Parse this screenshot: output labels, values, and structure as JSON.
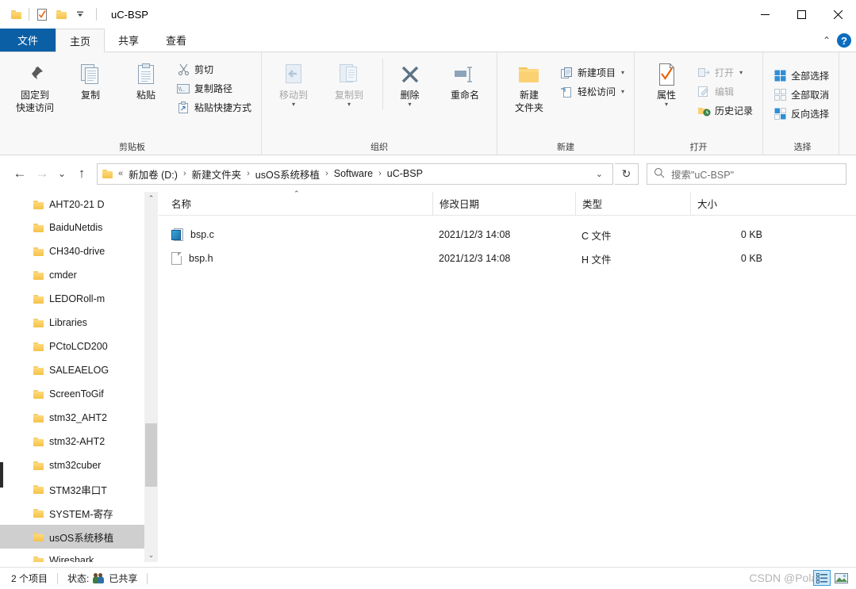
{
  "window": {
    "title": "uC-BSP",
    "quick_access": [
      {
        "name": "folder-icon",
        "label": "文件资源管理器"
      },
      {
        "name": "properties-icon",
        "label": "属性"
      },
      {
        "name": "new-folder-icon",
        "label": "新建文件夹"
      },
      {
        "name": "customize-caret-icon",
        "label": "自定义快速访问工具栏"
      }
    ],
    "controls": {
      "minimize": "─",
      "maximize": "☐",
      "close": "✕"
    }
  },
  "tabs": [
    {
      "label": "文件",
      "state": "file"
    },
    {
      "label": "主页",
      "state": "active"
    },
    {
      "label": "共享",
      "state": "normal"
    },
    {
      "label": "查看",
      "state": "normal"
    }
  ],
  "tabrow_right": {
    "collapse": "⌃",
    "help": "?"
  },
  "ribbon": {
    "groups": [
      {
        "title": "剪贴板",
        "big": [
          {
            "label1": "固定到",
            "label2": "快速访问",
            "icon": "pin-icon"
          },
          {
            "label1": "复制",
            "label2": "",
            "icon": "copy-icon"
          },
          {
            "label1": "粘贴",
            "label2": "",
            "icon": "paste-icon"
          }
        ],
        "small": [
          {
            "label": "剪切",
            "icon": "cut-icon",
            "disabled": false
          },
          {
            "label": "复制路径",
            "icon": "copy-path-icon",
            "disabled": false
          },
          {
            "label": "粘贴快捷方式",
            "icon": "paste-shortcut-icon",
            "disabled": false
          }
        ]
      },
      {
        "title": "组织",
        "big": [
          {
            "label1": "移动到",
            "label2": "",
            "icon": "move-to-icon",
            "disabled": true,
            "caret": true
          },
          {
            "label1": "复制到",
            "label2": "",
            "icon": "copy-to-icon",
            "disabled": true,
            "caret": true
          },
          {
            "label1": "删除",
            "label2": "",
            "icon": "delete-icon",
            "caret": true
          },
          {
            "label1": "重命名",
            "label2": "",
            "icon": "rename-icon"
          }
        ],
        "small": []
      },
      {
        "title": "新建",
        "big": [
          {
            "label1": "新建",
            "label2": "文件夹",
            "icon": "new-folder-icon"
          }
        ],
        "small": [
          {
            "label": "新建项目",
            "icon": "new-item-icon",
            "caret": true
          },
          {
            "label": "轻松访问",
            "icon": "easy-access-icon",
            "caret": true
          }
        ]
      },
      {
        "title": "打开",
        "big": [
          {
            "label1": "属性",
            "label2": "",
            "icon": "properties-icon",
            "caret": true
          }
        ],
        "small": [
          {
            "label": "打开",
            "icon": "open-icon",
            "disabled": true,
            "caret": true
          },
          {
            "label": "编辑",
            "icon": "edit-icon",
            "disabled": true
          },
          {
            "label": "历史记录",
            "icon": "history-icon"
          }
        ]
      },
      {
        "title": "选择",
        "big": [],
        "small": [
          {
            "label": "全部选择",
            "icon": "select-all-icon"
          },
          {
            "label": "全部取消",
            "icon": "select-none-icon"
          },
          {
            "label": "反向选择",
            "icon": "invert-selection-icon"
          }
        ]
      }
    ]
  },
  "address": {
    "back": "←",
    "forward": "→",
    "recent": "⌄",
    "up": "↑",
    "root_chevron": "«",
    "crumbs": [
      "新加卷 (D:)",
      "新建文件夹",
      "usOS系统移植",
      "Software",
      "uC-BSP"
    ],
    "dropdown_caret": "⌄",
    "refresh": "↻"
  },
  "search": {
    "icon": "search-icon",
    "placeholder": "搜索\"uC-BSP\""
  },
  "nav_pane": {
    "items": [
      {
        "label": "AHT20-21 D",
        "selected": false
      },
      {
        "label": "BaiduNetdis",
        "selected": false
      },
      {
        "label": "CH340-drive",
        "selected": false
      },
      {
        "label": "cmder",
        "selected": false
      },
      {
        "label": "LEDORoll-m",
        "selected": false
      },
      {
        "label": "Libraries",
        "selected": false
      },
      {
        "label": "PCtoLCD200",
        "selected": false
      },
      {
        "label": "SALEAELOG",
        "selected": false
      },
      {
        "label": "ScreenToGif",
        "selected": false
      },
      {
        "label": "stm32_AHT2",
        "selected": false
      },
      {
        "label": "stm32-AHT2",
        "selected": false
      },
      {
        "label": "stm32cuber",
        "selected": false
      },
      {
        "label": "STM32串口T",
        "selected": false
      },
      {
        "label": "SYSTEM-寄存",
        "selected": false
      },
      {
        "label": "usOS系统移植",
        "selected": true
      },
      {
        "label": "Wireshark",
        "selected": false
      }
    ],
    "scroll_up": "⌃",
    "scroll_down": "⌄"
  },
  "file_list": {
    "columns": [
      {
        "key": "name",
        "label": "名称",
        "sorted": true,
        "sort_caret": "⌃"
      },
      {
        "key": "date",
        "label": "修改日期"
      },
      {
        "key": "type",
        "label": "类型"
      },
      {
        "key": "size",
        "label": "大小"
      }
    ],
    "rows": [
      {
        "icon": "c-file-icon",
        "name": "bsp.c",
        "date": "2021/12/3 14:08",
        "type": "C 文件",
        "size": "0 KB"
      },
      {
        "icon": "h-file-icon",
        "name": "bsp.h",
        "date": "2021/12/3 14:08",
        "type": "H 文件",
        "size": "0 KB"
      }
    ]
  },
  "status_bar": {
    "item_count": "2 个项目",
    "status_label": "状态:",
    "share_state": "已共享",
    "share_icon": "people-icon"
  },
  "view_buttons": [
    {
      "name": "details-view-button",
      "active": true
    },
    {
      "name": "large-icons-view-button",
      "active": false
    }
  ],
  "watermark": "CSDN @Polaris"
}
